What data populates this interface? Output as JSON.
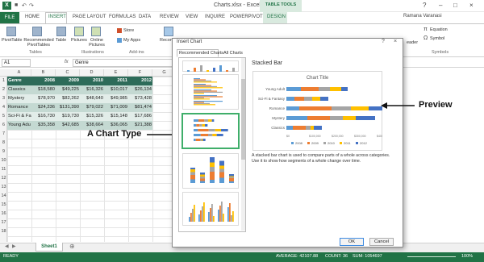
{
  "window": {
    "title": "Charts.xlsx - Excel",
    "tools_group": "TABLE TOOLS",
    "user": "Ramana Varanasi",
    "controls": [
      "?",
      "–",
      "□",
      "×"
    ]
  },
  "qat": {
    "save": "■",
    "undo": "↶",
    "redo": "↷"
  },
  "ribbon": {
    "tabs": [
      "FILE",
      "HOME",
      "INSERT",
      "PAGE LAYOUT",
      "FORMULAS",
      "DATA",
      "REVIEW",
      "VIEW",
      "INQUIRE",
      "POWERPIVOT",
      "DESIGN"
    ],
    "buttons": {
      "pivot": "PivotTable",
      "rec_pivot": "Recommended PivotTables",
      "table": "Table",
      "pictures": "Pictures",
      "online_pictures": "Online Pictures",
      "store": "Store",
      "my_apps": "My Apps",
      "recommended": "Recommended",
      "reader": "eader",
      "equation": "Equation",
      "symbol": "Symbol"
    },
    "groups": {
      "tables": "Tables",
      "illustrations": "Illustrations",
      "addins": "Add-ins",
      "symbols": "Symbols"
    }
  },
  "formula_bar": {
    "name_box": "A1",
    "fx": "fx",
    "content": "Genre"
  },
  "columns": [
    "A",
    "B",
    "C",
    "D",
    "E",
    "F",
    "G"
  ],
  "rows": [
    "1",
    "2",
    "3",
    "4",
    "5",
    "6",
    "7",
    "8",
    "9",
    "10",
    "11",
    "12",
    "13",
    "14",
    "15",
    "16",
    "17",
    "18"
  ],
  "table": {
    "headers": [
      "Genre",
      "2008",
      "2009",
      "2010",
      "2011",
      "2012"
    ],
    "data": [
      [
        "Classics",
        "$18,580",
        "$49,225",
        "$16,326",
        "$10,017",
        "$26,134"
      ],
      [
        "Mystery",
        "$78,970",
        "$82,262",
        "$48,640",
        "$49,985",
        "$73,428"
      ],
      [
        "Romance",
        "$24,236",
        "$131,390",
        "$79,022",
        "$71,009",
        "$81,474"
      ],
      [
        "Sci-Fi & Fa",
        "$16,730",
        "$19,730",
        "$15,326",
        "$15,148",
        "$17,686"
      ],
      [
        "Young Adu",
        "$35,358",
        "$42,685",
        "$38,664",
        "$36,065",
        "$21,388"
      ]
    ]
  },
  "dialog": {
    "title": "Insert Chart",
    "controls": [
      "?",
      "×"
    ],
    "tabs": [
      "Recommended Charts",
      "All Charts"
    ],
    "chart_type": "Stacked Bar",
    "preview_title": "Chart Title",
    "description": "A stacked bar chart is used to compare parts of a whole across categories. Use it to show how segments of a whole change over time.",
    "ok": "OK",
    "cancel": "Cancel"
  },
  "preview_chart": {
    "categories": [
      "Young Adult",
      "Sci-Fi & Fantasy",
      "Romance",
      "Mystery",
      "Classics"
    ],
    "legend": [
      "2008",
      "2009",
      "2010",
      "2011",
      "2012"
    ],
    "colors": [
      "#5b9bd5",
      "#ed7d31",
      "#a5a5a5",
      "#ffc000",
      "#4472c4"
    ],
    "axis_ticks": [
      "$0",
      "$100,000",
      "$200,000",
      "$300,000",
      "$400,000"
    ]
  },
  "callouts": {
    "chart_type": "A Chart Type",
    "preview": "Preview"
  },
  "sheet": {
    "tab": "Sheet1"
  },
  "status": {
    "mode": "READY",
    "average": "AVERAGE: 42107.88",
    "count": "COUNT: 36",
    "sum": "SUM: 1054697",
    "zoom": "100%"
  }
}
